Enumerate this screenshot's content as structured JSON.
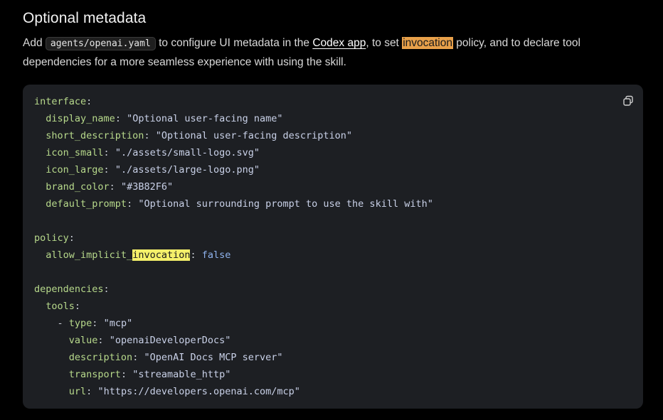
{
  "heading": "Optional metadata",
  "intro": {
    "part1": "Add ",
    "file": "agents/openai.yaml",
    "part2": " to configure UI metadata in the ",
    "link": "Codex app",
    "part3": ", to set ",
    "highlight": "invocation",
    "part4": " policy, and to declare tool dependencies for a more seamless experience with using the skill."
  },
  "code": {
    "copy_icon": "copy-icon",
    "interface_key": "interface",
    "display_name_key": "display_name",
    "display_name_val": "\"Optional user-facing name\"",
    "short_description_key": "short_description",
    "short_description_val": "\"Optional user-facing description\"",
    "icon_small_key": "icon_small",
    "icon_small_val": "\"./assets/small-logo.svg\"",
    "icon_large_key": "icon_large",
    "icon_large_val": "\"./assets/large-logo.png\"",
    "brand_color_key": "brand_color",
    "brand_color_val": "\"#3B82F6\"",
    "default_prompt_key": "default_prompt",
    "default_prompt_val": "\"Optional surrounding prompt to use the skill with\"",
    "policy_key": "policy",
    "allow_key_prefix": "allow_implicit_",
    "allow_key_highlight": "invocation",
    "allow_val": "false",
    "dependencies_key": "dependencies",
    "tools_key": "tools",
    "dash": "- ",
    "type_key": "type",
    "type_val": "\"mcp\"",
    "value_key": "value",
    "value_val": "\"openaiDeveloperDocs\"",
    "description_key": "description",
    "description_val": "\"OpenAI Docs MCP server\"",
    "transport_key": "transport",
    "transport_val": "\"streamable_http\"",
    "url_key": "url",
    "url_val": "\"https://developers.openai.com/mcp\""
  },
  "colors": {
    "highlight_orange": "#e8a04a",
    "highlight_yellow": "#f5f06a",
    "code_bg": "#1d1f23",
    "key": "#b7d98b"
  }
}
